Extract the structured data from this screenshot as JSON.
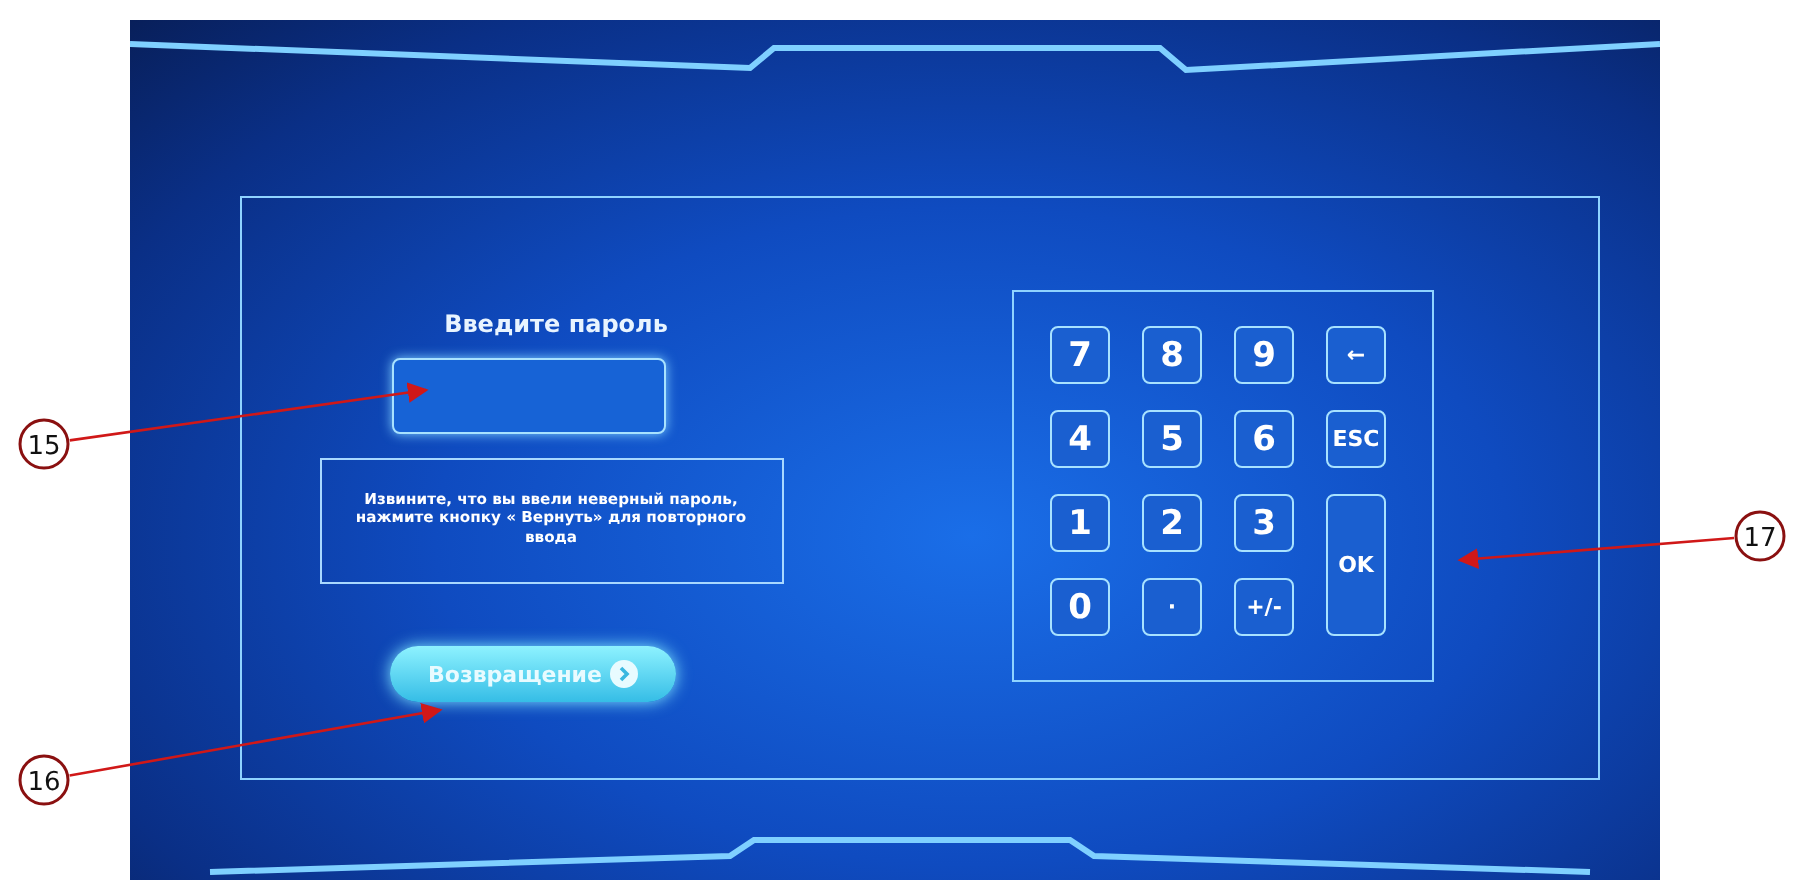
{
  "password_panel": {
    "title": "Введите пароль",
    "message": "Извините, что  вы ввели неверный пароль, нажмите кнопку « Вернуть» для повторного ввода",
    "return_button": "Возвращение"
  },
  "keypad": {
    "keys": [
      {
        "label": "7",
        "kind": "key"
      },
      {
        "label": "8",
        "kind": "key"
      },
      {
        "label": "9",
        "kind": "key"
      },
      {
        "label": "←",
        "kind": "key"
      },
      {
        "label": "4",
        "kind": "key"
      },
      {
        "label": "5",
        "kind": "key"
      },
      {
        "label": "6",
        "kind": "key"
      },
      {
        "label": "ESC",
        "kind": "key"
      },
      {
        "label": "1",
        "kind": "key"
      },
      {
        "label": "2",
        "kind": "key"
      },
      {
        "label": "3",
        "kind": "key"
      },
      {
        "label": "OK",
        "kind": "tall"
      },
      {
        "label": "0",
        "kind": "key"
      },
      {
        "label": "·",
        "kind": "key"
      },
      {
        "label": "+/-",
        "kind": "key"
      }
    ]
  },
  "callouts": [
    {
      "number": "15"
    },
    {
      "number": "16"
    },
    {
      "number": "17"
    }
  ]
}
